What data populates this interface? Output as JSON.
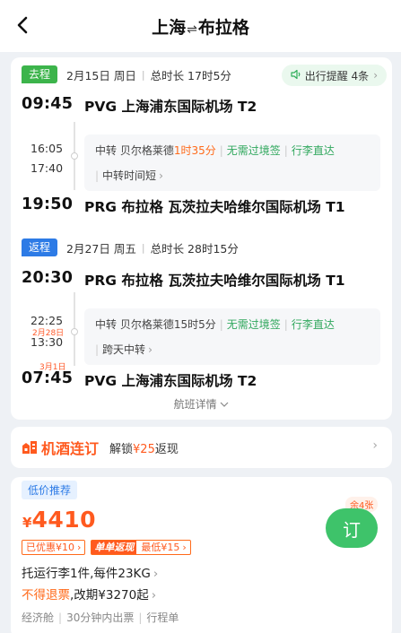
{
  "header": {
    "from": "上海",
    "to": "布拉格",
    "arrows": "⇌"
  },
  "outbound": {
    "badge": "去程",
    "date": "2月15日 周日",
    "duration": "总时长 17时5分",
    "reminder": "出行提醒 4条",
    "dep_time": "09:45",
    "dep_airport": "PVG 上海浦东国际机场 T2",
    "stop_arr": "16:05",
    "stop_dep": "17:40",
    "transfer_prefix": "中转 贝尔格莱德",
    "transfer_duration": "1时35分",
    "no_visa": "无需过境签",
    "baggage": "行李直达",
    "note": "中转时间短",
    "arr_time": "19:50",
    "arr_airport": "PRG 布拉格 瓦茨拉夫哈维尔国际机场 T1"
  },
  "return": {
    "badge": "返程",
    "date": "2月27日 周五",
    "duration": "总时长 28时15分",
    "dep_time": "20:30",
    "dep_airport": "PRG 布拉格 瓦茨拉夫哈维尔国际机场 T1",
    "stop_arr": "22:25",
    "stop_date": "2月28日",
    "stop_dep": "13:30",
    "transfer_text": "中转 贝尔格莱德15时5分",
    "no_visa": "无需过境签",
    "baggage": "行李直达",
    "note": "跨天中转",
    "arr_date": "3月1日",
    "arr_time": "07:45",
    "arr_airport": "PVG 上海浦东国际机场 T2"
  },
  "details_link": "航班详情",
  "promo": {
    "title": "机酒连订",
    "text_prefix": "解锁",
    "amount": "¥25",
    "text_suffix": "返现"
  },
  "offer": {
    "tag": "低价推荐",
    "currency": "¥",
    "price": "4410",
    "discount": "已优惠¥10",
    "promo_label": "单单返现",
    "promo_value": "最低¥15",
    "baggage": "托运行李1件,每件23KG",
    "refund_warning": "不得退票",
    "change_fee": ",改期¥3270起",
    "cabin": "经济舱",
    "issue_time": "30分钟内出票",
    "itinerary": "行程单",
    "remaining": "余4张",
    "book_label": "订"
  },
  "colors": {
    "accent_green": "#3ec36a",
    "accent_orange": "#ff5a1f",
    "accent_blue": "#2d7be6"
  }
}
